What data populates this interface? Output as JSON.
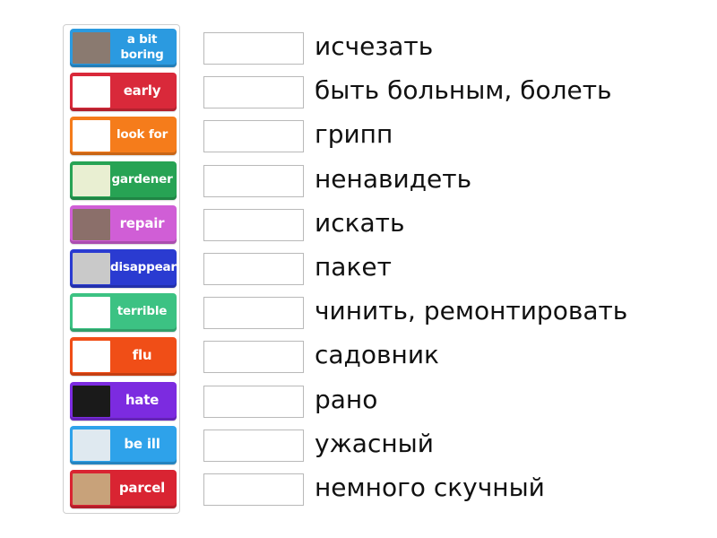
{
  "cards": [
    {
      "label": "a bit boring",
      "label_lines": [
        "a bit",
        "boring"
      ],
      "color": "#2b9ae0",
      "image": "man-in-suit-photo",
      "image_bg": "#8a7a70"
    },
    {
      "label": "early",
      "color": "#d9293a",
      "image": "bird-cartoon",
      "image_bg": "#ffffff"
    },
    {
      "label": "look for",
      "color": "#f57c1b",
      "image": "man-with-binoculars-cartoon",
      "image_bg": "#ffffff"
    },
    {
      "label": "gardener",
      "color": "#27a354",
      "image": "gardeners-cartoon",
      "image_bg": "#e9efd2"
    },
    {
      "label": "repair",
      "color": "#d05ed6",
      "image": "car-repair-photo",
      "image_bg": "#8b6f6a"
    },
    {
      "label": "disappear",
      "color": "#2a3bd1",
      "image": "disappearing-man-photo",
      "image_bg": "#c9c9c9"
    },
    {
      "label": "terrible",
      "color": "#3cc283",
      "image": "purple-monster-cartoon",
      "image_bg": "#ffffff"
    },
    {
      "label": "flu",
      "color": "#f04e17",
      "image": "flu-shot-poster",
      "image_bg": "#ffffff"
    },
    {
      "label": "hate",
      "color": "#7c2be0",
      "image": "i-hate-you-photo",
      "image_bg": "#1a1a1a"
    },
    {
      "label": "be ill",
      "color": "#2ea2ea",
      "image": "sick-man-in-bed-cartoon",
      "image_bg": "#dfe9f0"
    },
    {
      "label": "parcel",
      "color": "#d92432",
      "image": "cardboard-parcel-photo",
      "image_bg": "#c8a27a"
    }
  ],
  "terms": [
    "исчезать",
    "быть больным, болеть",
    "грипп",
    "ненавидеть",
    "искать",
    "пакет",
    "чинить, ремонтировать",
    "садовник",
    "рано",
    "ужасный",
    "немного скучный"
  ]
}
